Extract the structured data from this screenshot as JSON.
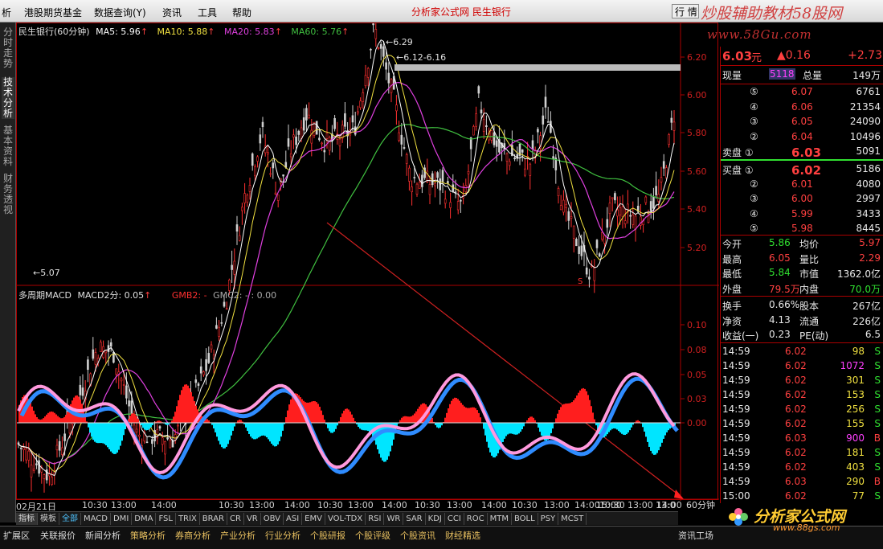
{
  "menubar": {
    "items": [
      "析",
      "港股期货基金",
      "数据查询(Y)",
      "资讯",
      "工具",
      "帮助"
    ],
    "center_title": "分析家公式网  民生银行",
    "quote_button": "行 情",
    "brand": "炒股辅助教材58股网",
    "brand_url": "www.58Gu.com"
  },
  "left_tabs": [
    "分时走势",
    "技术分析",
    "基本资料",
    "财务透视"
  ],
  "main_chart": {
    "legend": {
      "title": "民生银行(60分钟)",
      "ma5": "MA5: 5.96",
      "ma10": "MA10: 5.88",
      "ma20": "MA20: 5.83",
      "ma60": "MA60: 5.76"
    },
    "price_ticks": [
      "6.20",
      "6.00",
      "5.80",
      "5.60",
      "5.40",
      "5.20"
    ],
    "annotations": [
      "6.29",
      "6.12-6.16",
      "5.07"
    ],
    "colors": {
      "ma5": "#ffffff",
      "ma10": "#f0e040",
      "ma20": "#e040e0",
      "ma60": "#40c040",
      "axis_red": "#cc0000"
    }
  },
  "sub_chart": {
    "legend": {
      "title": "多周期MACD",
      "macd2": "MACD2分: 0.05",
      "gmb": "GMB2: -",
      "gmc": "GMC2: - : 0.00"
    },
    "ticks": [
      "0.10",
      "0.08",
      "0.05",
      "0.03",
      "0.00"
    ]
  },
  "time_axis": [
    "02月21日",
    "10:30",
    "13:00",
    "14:00",
    "10:30",
    "13:00",
    "14:00",
    "10:30",
    "13:00",
    "14:00",
    "10:30",
    "13:00",
    "14:00",
    "10:30",
    "13:00",
    "14:00",
    "10:30",
    "13:00",
    "14:00",
    "15:00",
    "10:30",
    "13:0"
  ],
  "period": "60分钟",
  "indicator_tabs": [
    "指标",
    "模板",
    "全部",
    "MACD",
    "DMI",
    "DMA",
    "FSL",
    "TRIX",
    "BRAR",
    "CR",
    "VR",
    "OBV",
    "ASI",
    "EMV",
    "VOL-TDX",
    "RSI",
    "WR",
    "SAR",
    "KDJ",
    "CCI",
    "ROC",
    "MTM",
    "BOLL",
    "PSY",
    "MCST"
  ],
  "bottom_nav": [
    "扩展区",
    "关联报价",
    "新闻分析",
    "策略分析",
    "券商分析",
    "产业分析",
    "行业分析",
    "个股研报",
    "个股评级",
    "个股资讯",
    "财经精选",
    "资讯工场"
  ],
  "quote": {
    "price": "6.03",
    "unit": "元",
    "change": "▲0.16",
    "change_pct": "+2.73",
    "xianliang_label": "现量",
    "xianliang": "5118",
    "zongliang_label": "总量",
    "zongliang": "149万",
    "asks": [
      {
        "label": "⑤",
        "price": "6.07",
        "vol": "6761"
      },
      {
        "label": "④",
        "price": "6.06",
        "vol": "21354"
      },
      {
        "label": "③",
        "price": "6.05",
        "vol": "24090"
      },
      {
        "label": "②",
        "price": "6.04",
        "vol": "10496"
      },
      {
        "label": "卖盘 ①",
        "price": "6.03",
        "vol": "5091"
      }
    ],
    "bids": [
      {
        "label": "买盘 ①",
        "price": "6.02",
        "vol": "5186"
      },
      {
        "label": "②",
        "price": "6.01",
        "vol": "4080"
      },
      {
        "label": "③",
        "price": "6.00",
        "vol": "2997"
      },
      {
        "label": "④",
        "price": "5.99",
        "vol": "3433"
      },
      {
        "label": "⑤",
        "price": "5.98",
        "vol": "8445"
      }
    ],
    "stats": [
      {
        "l1": "今开",
        "v1": "5.86",
        "l2": "均价",
        "v2": "5.97"
      },
      {
        "l1": "最高",
        "v1": "6.05",
        "l2": "量比",
        "v2": "2.29"
      },
      {
        "l1": "最低",
        "v1": "5.84",
        "l2": "市值",
        "v2": "1362.0亿"
      },
      {
        "l1": "外盘",
        "v1": "79.5万",
        "l2": "内盘",
        "v2": "70.0万"
      }
    ],
    "fundamentals": [
      {
        "l1": "换手",
        "v1": "0.66%",
        "l2": "股本",
        "v2": "267亿"
      },
      {
        "l1": "净资",
        "v1": "4.13",
        "l2": "流通",
        "v2": "226亿"
      },
      {
        "l1": "收益(一)",
        "v1": "0.23",
        "l2": "PE(动)",
        "v2": "6.5"
      }
    ],
    "ticks": [
      {
        "time": "14:59",
        "price": "6.02",
        "vol": "98",
        "side": "S"
      },
      {
        "time": "14:59",
        "price": "6.02",
        "vol": "1072",
        "side": "S"
      },
      {
        "time": "14:59",
        "price": "6.02",
        "vol": "301",
        "side": "S"
      },
      {
        "time": "14:59",
        "price": "6.02",
        "vol": "153",
        "side": "S"
      },
      {
        "time": "14:59",
        "price": "6.02",
        "vol": "256",
        "side": "S"
      },
      {
        "time": "14:59",
        "price": "6.02",
        "vol": "155",
        "side": "S"
      },
      {
        "time": "14:59",
        "price": "6.03",
        "vol": "900",
        "side": "B"
      },
      {
        "time": "14:59",
        "price": "6.02",
        "vol": "181",
        "side": "S"
      },
      {
        "time": "14:59",
        "price": "6.02",
        "vol": "403",
        "side": "S"
      },
      {
        "time": "14:59",
        "price": "6.03",
        "vol": "290",
        "side": "B"
      },
      {
        "time": "15:00",
        "price": "6.02",
        "vol": "77",
        "side": "S"
      }
    ]
  },
  "logo": {
    "text": "分析家公式网",
    "url": "www.88gs.com"
  }
}
